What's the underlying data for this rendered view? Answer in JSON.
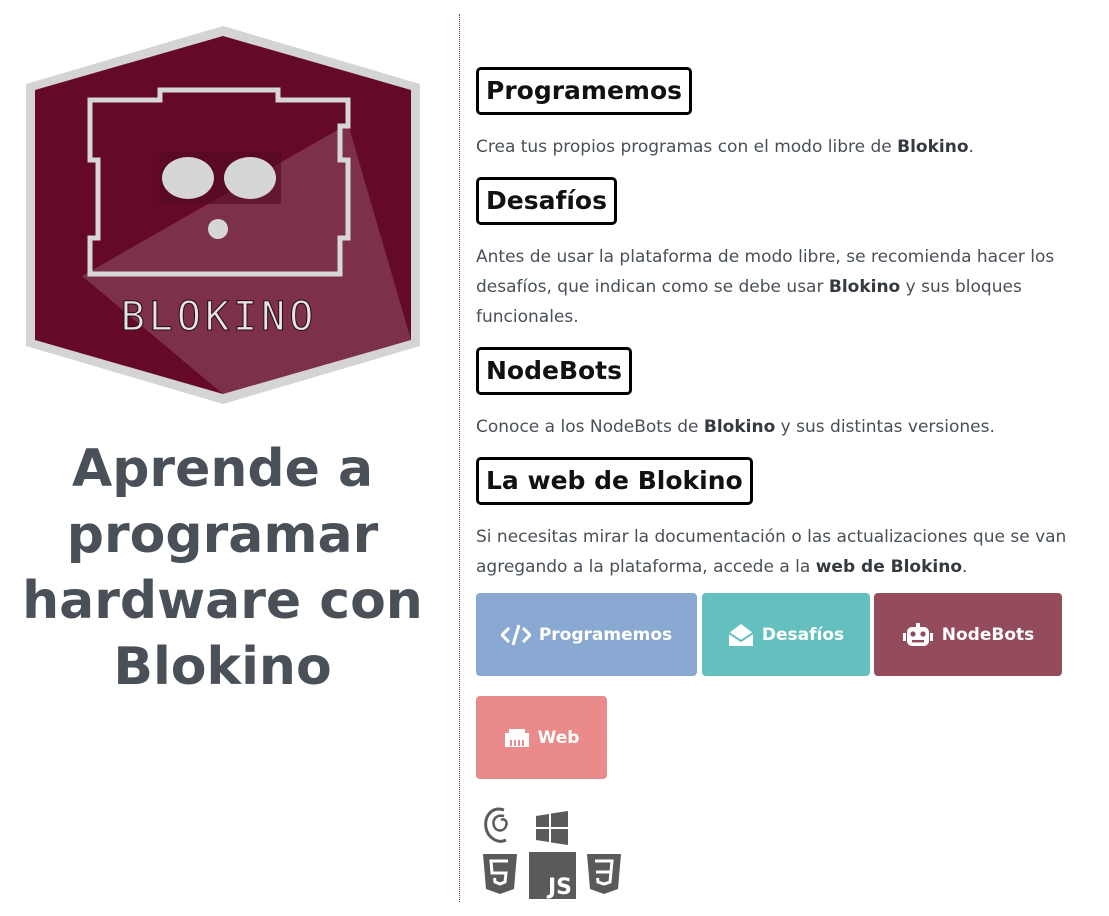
{
  "brand": {
    "logo_text": "BLOKINO",
    "tagline": "Aprende a programar hardware con Blokino"
  },
  "sections": [
    {
      "title": "Programemos",
      "text_before": "Crea tus propios programas con el modo libre de ",
      "text_bold": "Blokino",
      "text_after": "."
    },
    {
      "title": "Desafíos",
      "text_before": "Antes de usar la plataforma de modo libre, se recomienda hacer los desafíos, que indican como se debe usar ",
      "text_bold": "Blokino",
      "text_after": " y sus bloques funcionales."
    },
    {
      "title": "NodeBots",
      "text_before": "Conoce a los NodeBots de ",
      "text_bold": "Blokino",
      "text_after": " y sus distintas versiones."
    },
    {
      "title": "La web de Blokino",
      "text_before": "Si necesitas mirar la documentación o las actualizaciones que se van agregando a la plataforma, accede a la ",
      "text_bold": "web de Blokino",
      "text_after": "."
    }
  ],
  "buttons": [
    {
      "label": "Programemos",
      "icon": "code-icon",
      "color": "#8aa9d2"
    },
    {
      "label": "Desafíos",
      "icon": "envelope-open-icon",
      "color": "#63c0bf"
    },
    {
      "label": "NodeBots",
      "icon": "robot-icon",
      "color": "#944b5c"
    },
    {
      "label": "Web",
      "icon": "network-icon",
      "color": "#eb8a8a"
    }
  ],
  "tech_icons": {
    "names": [
      "debian-icon",
      "windows-icon",
      "html5-icon",
      "javascript-icon",
      "css3-icon"
    ],
    "js_label": "JS",
    "color": "#5a5a5a"
  },
  "colors": {
    "logo_border": "#d4d4d4",
    "logo_fill": "#640a27",
    "divider": "#7a3040",
    "text": "#495057"
  }
}
